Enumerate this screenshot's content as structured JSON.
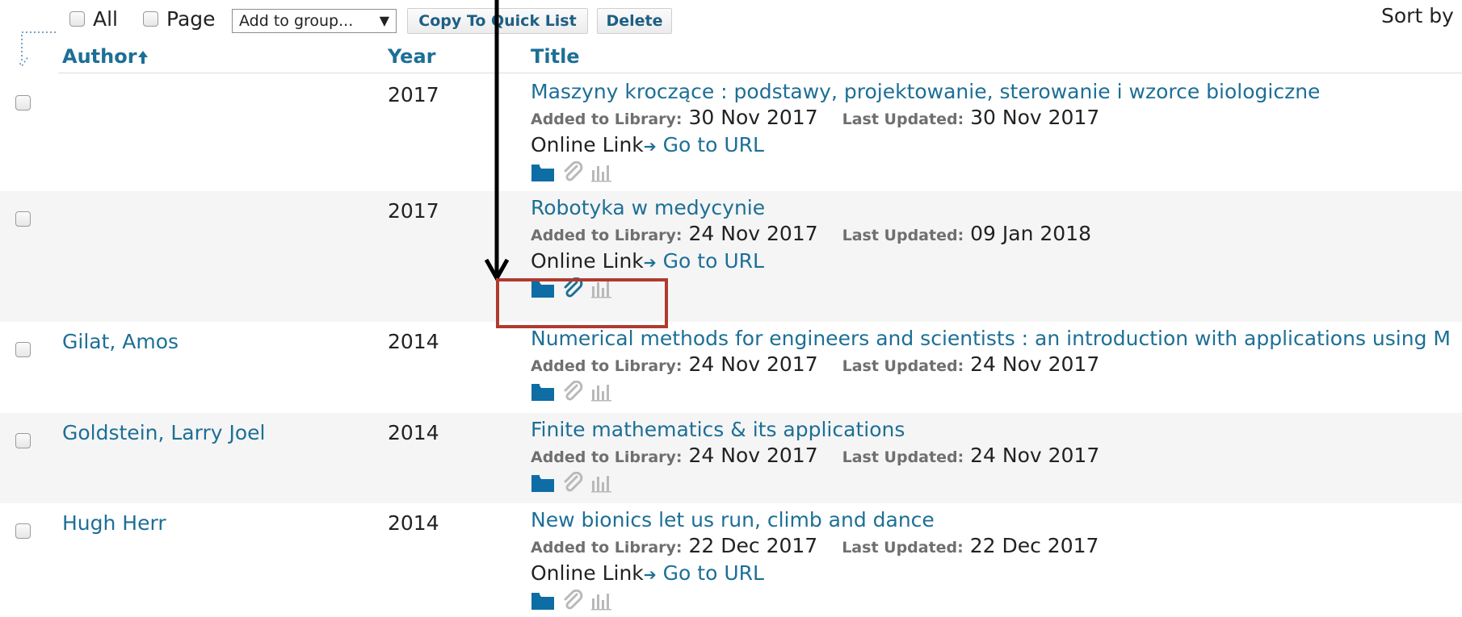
{
  "toolbar": {
    "all_label": "All",
    "page_label": "Page",
    "group_select_value": "Add to group...",
    "copy_button": "Copy To Quick List",
    "delete_button": "Delete",
    "sort_label": "Sort by"
  },
  "columns": {
    "author": "Author",
    "year": "Year",
    "title": "Title"
  },
  "labels": {
    "added": "Added to Library:",
    "updated": "Last Updated:",
    "online_link": "Online Link",
    "go_to_url": "Go to URL"
  },
  "icons": {
    "folder": "folder-icon",
    "attachment": "paperclip-icon",
    "stats": "bar-chart-icon",
    "sort": "sort-ascending-arrow-icon"
  },
  "colors": {
    "link": "#1d6f96",
    "folder": "#0e6da4",
    "attachment_active": "#1d6f96",
    "attachment_inactive": "#b9b9b9",
    "stats": "#b9b9b9",
    "highlight": "#b03a2e"
  },
  "rows": [
    {
      "author": "",
      "year": "2017",
      "title": "Maszyny kroczące : podstawy, projektowanie, sterowanie i wzorce biologiczne",
      "added": "30 Nov 2017",
      "updated": "30 Nov 2017",
      "has_online_link": true,
      "attachment_active": false
    },
    {
      "author": "",
      "year": "2017",
      "title": "Robotyka w medycynie",
      "added": "24 Nov 2017",
      "updated": "09 Jan 2018",
      "has_online_link": true,
      "attachment_active": true
    },
    {
      "author": "Gilat, Amos",
      "year": "2014",
      "title": "Numerical methods for engineers and scientists : an introduction with applications using M",
      "added": "24 Nov 2017",
      "updated": "24 Nov 2017",
      "has_online_link": false,
      "attachment_active": false
    },
    {
      "author": "Goldstein, Larry Joel",
      "year": "2014",
      "title": "Finite mathematics & its applications",
      "added": "24 Nov 2017",
      "updated": "24 Nov 2017",
      "has_online_link": false,
      "attachment_active": false
    },
    {
      "author": "Hugh Herr",
      "year": "2014",
      "title": "New bionics let us run, climb and dance",
      "added": "22 Dec 2017",
      "updated": "22 Dec 2017",
      "has_online_link": true,
      "attachment_active": false
    }
  ]
}
